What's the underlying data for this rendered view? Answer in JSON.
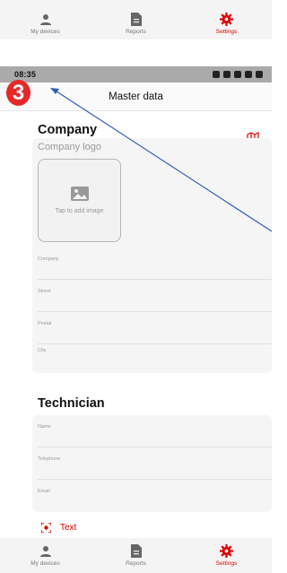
{
  "top_tabbar": {
    "tabs": [
      {
        "label": "My devices",
        "icon": "person-icon"
      },
      {
        "label": "Reports",
        "icon": "document-icon"
      },
      {
        "label": "Settings",
        "icon": "gear-icon",
        "active": true
      }
    ]
  },
  "status_bar": {
    "time": "08:35"
  },
  "header": {
    "title": "Master data"
  },
  "annotation": {
    "step": "3"
  },
  "company": {
    "title": "Company",
    "logo_label": "Company logo",
    "logo_hint": "Tap to add image",
    "fields": [
      "Company",
      "Street",
      "Postal",
      "City"
    ]
  },
  "technician": {
    "title": "Technician",
    "fields": [
      "Name",
      "Telephone",
      "Email"
    ]
  },
  "text_action": {
    "label": "Text"
  },
  "bottom_tabbar": {
    "tabs": [
      {
        "label": "My devices",
        "icon": "person-icon"
      },
      {
        "label": "Reports",
        "icon": "document-icon"
      },
      {
        "label": "Settings",
        "icon": "gear-icon",
        "active": true
      }
    ]
  },
  "colors": {
    "accent": "#e00000",
    "badge": "#e62828",
    "arrow": "#2e5fb8"
  }
}
